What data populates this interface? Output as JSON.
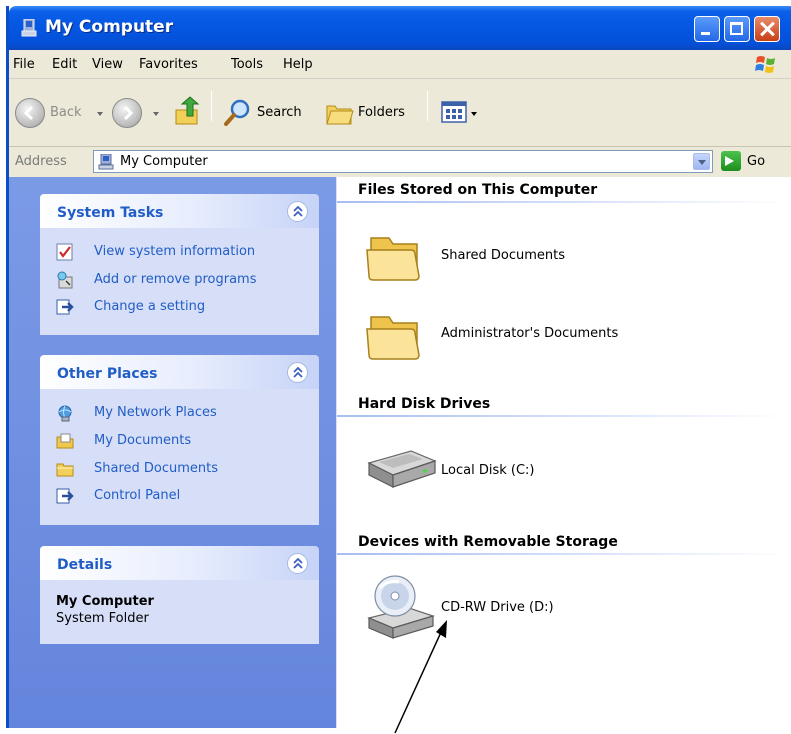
{
  "window": {
    "title": "My Computer"
  },
  "menu": [
    "File",
    "Edit",
    "View",
    "Favorites",
    "Tools",
    "Help"
  ],
  "toolbar": {
    "back_label": "Back",
    "search_label": "Search",
    "folders_label": "Folders"
  },
  "address": {
    "label": "Address",
    "value": "My Computer",
    "go_label": "Go"
  },
  "left_pane": {
    "system_tasks": {
      "title": "System Tasks",
      "items": [
        {
          "label": "View system information",
          "icon": "system-info-icon"
        },
        {
          "label": "Add or remove programs",
          "icon": "add-remove-programs-icon"
        },
        {
          "label": "Change a setting",
          "icon": "control-panel-icon"
        }
      ]
    },
    "other_places": {
      "title": "Other Places",
      "items": [
        {
          "label": "My Network Places",
          "icon": "network-places-icon"
        },
        {
          "label": "My Documents",
          "icon": "my-documents-icon"
        },
        {
          "label": "Shared Documents",
          "icon": "folder-icon"
        },
        {
          "label": "Control Panel",
          "icon": "control-panel-icon"
        }
      ]
    },
    "details": {
      "title": "Details",
      "name": "My Computer",
      "type": "System Folder"
    }
  },
  "content": {
    "groups": [
      {
        "title": "Files Stored on This Computer",
        "items": [
          {
            "label": "Shared Documents",
            "icon": "folder-icon"
          },
          {
            "label": "Administrator's Documents",
            "icon": "folder-icon"
          }
        ]
      },
      {
        "title": "Hard Disk Drives",
        "items": [
          {
            "label": "Local Disk (C:)",
            "icon": "hard-disk-icon"
          }
        ]
      },
      {
        "title": "Devices with Removable Storage",
        "items": [
          {
            "label": "CD-RW Drive (D:)",
            "icon": "cd-drive-icon"
          }
        ]
      }
    ]
  },
  "colors": {
    "titlebar": "#0556e2",
    "task_pane": "#6f8fe0",
    "panel_body": "#d6dff7",
    "link_blue": "#215dc6",
    "menu_bg": "#ece9d8"
  }
}
